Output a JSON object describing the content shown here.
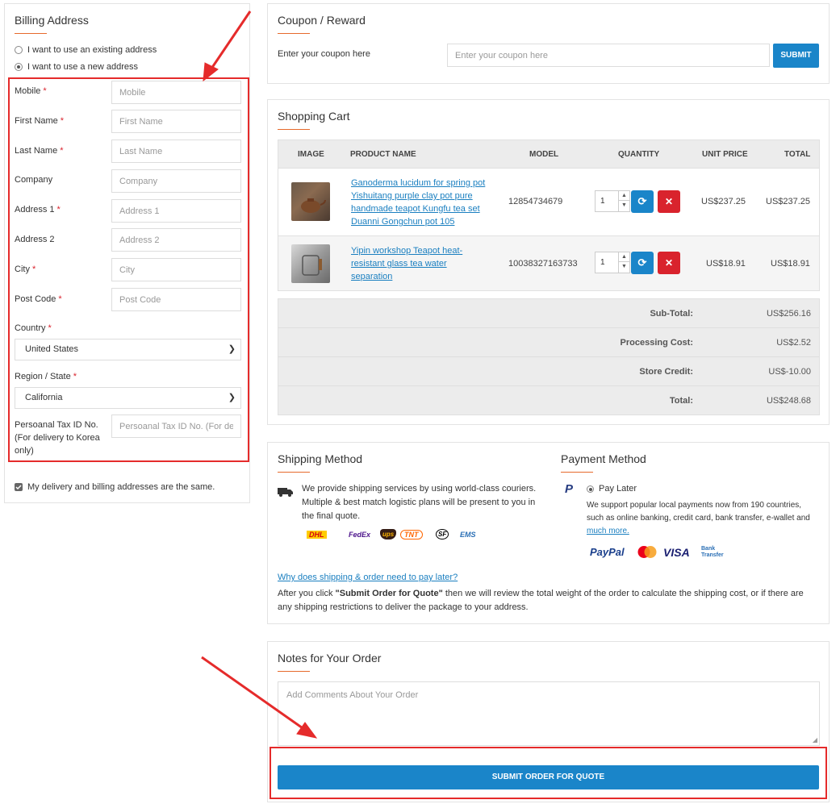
{
  "billing": {
    "title": "Billing Address",
    "radio_existing": "I want to use an existing address",
    "radio_new": "I want to use a new address",
    "fields": {
      "mobile": {
        "label": "Mobile",
        "placeholder": "Mobile"
      },
      "first_name": {
        "label": "First Name",
        "placeholder": "First Name"
      },
      "last_name": {
        "label": "Last Name",
        "placeholder": "Last Name"
      },
      "company": {
        "label": "Company",
        "placeholder": "Company"
      },
      "address1": {
        "label": "Address 1",
        "placeholder": "Address 1"
      },
      "address2": {
        "label": "Address 2",
        "placeholder": "Address 2"
      },
      "city": {
        "label": "City",
        "placeholder": "City"
      },
      "postcode": {
        "label": "Post Code",
        "placeholder": "Post Code"
      },
      "country": {
        "label": "Country",
        "value": "United States"
      },
      "region": {
        "label": "Region / State",
        "value": "California"
      },
      "tax_id": {
        "label_line1": "Persoanal Tax ID No.",
        "label_line2": "(For delivery to Korea",
        "label_line3": "only)",
        "placeholder": "Persoanal Tax ID No. (For de"
      }
    },
    "required_mark": "*",
    "same_address": "My delivery and billing addresses are the same."
  },
  "coupon": {
    "title": "Coupon / Reward",
    "label": "Enter your coupon here",
    "placeholder": "Enter your coupon here",
    "submit": "SUBMIT"
  },
  "cart": {
    "title": "Shopping Cart",
    "headers": {
      "image": "IMAGE",
      "product": "PRODUCT NAME",
      "model": "MODEL",
      "quantity": "QUANTITY",
      "unit_price": "UNIT PRICE",
      "total": "TOTAL"
    },
    "items": [
      {
        "name_l1": "Ganoderma lucidum for spring pot",
        "name_l2": "Yishuitang purple clay pot pure",
        "name_l3": "handmade teapot Kungfu tea set",
        "name_l4": "Duanni Gongchun pot 105",
        "model": "12854734679",
        "qty": "1",
        "unit_price": "US$237.25",
        "total": "US$237.25"
      },
      {
        "name_l1": "Yipin workshop Teapot heat-",
        "name_l2": "resistant glass tea water",
        "name_l3": "separation",
        "model": "10038327163733",
        "qty": "1",
        "unit_price": "US$18.91",
        "total": "US$18.91"
      }
    ],
    "totals": [
      {
        "label": "Sub-Total:",
        "value": "US$256.16"
      },
      {
        "label": "Processing Cost:",
        "value": "US$2.52"
      },
      {
        "label": "Store Credit:",
        "value": "US$-10.00"
      },
      {
        "label": "Total:",
        "value": "US$248.68"
      }
    ]
  },
  "shipping": {
    "title": "Shipping Method",
    "text_l1": "We provide shipping services by using world-class couriers.",
    "text_l2": "Multiple & best match logistic plans will be present to you in",
    "text_l3": "the final quote.",
    "carriers": [
      "DHL",
      "FedEx",
      "ups",
      "TNT",
      "SF",
      "EMS"
    ],
    "why_link": "Why does shipping & order need to pay later?",
    "after_l1_pre": "After you click ",
    "after_l1_bold": "\"Submit Order for Quote\"",
    "after_l1_post": " then we will review the total weight of the order to calculate the shipping cost, or if there are",
    "after_l2": "any shipping restrictions to deliver the package to your address."
  },
  "payment": {
    "title": "Payment Method",
    "option": "Pay Later",
    "text_l1": "We support popular local payments now from 190 countries,",
    "text_l2": "such as online banking, credit card, bank transfer, e-wallet and",
    "more_link": "much more.",
    "logos": [
      "PayPal",
      "VISA",
      "Bank Transfer"
    ]
  },
  "notes": {
    "title": "Notes for Your Order",
    "placeholder": "Add Comments About Your Order",
    "submit": "SUBMIT ORDER FOR QUOTE"
  },
  "colors": {
    "accent": "#e66a2c",
    "primary_blue": "#1a85c9",
    "danger_red": "#d9232d",
    "annotation_red": "#e52b2b"
  }
}
